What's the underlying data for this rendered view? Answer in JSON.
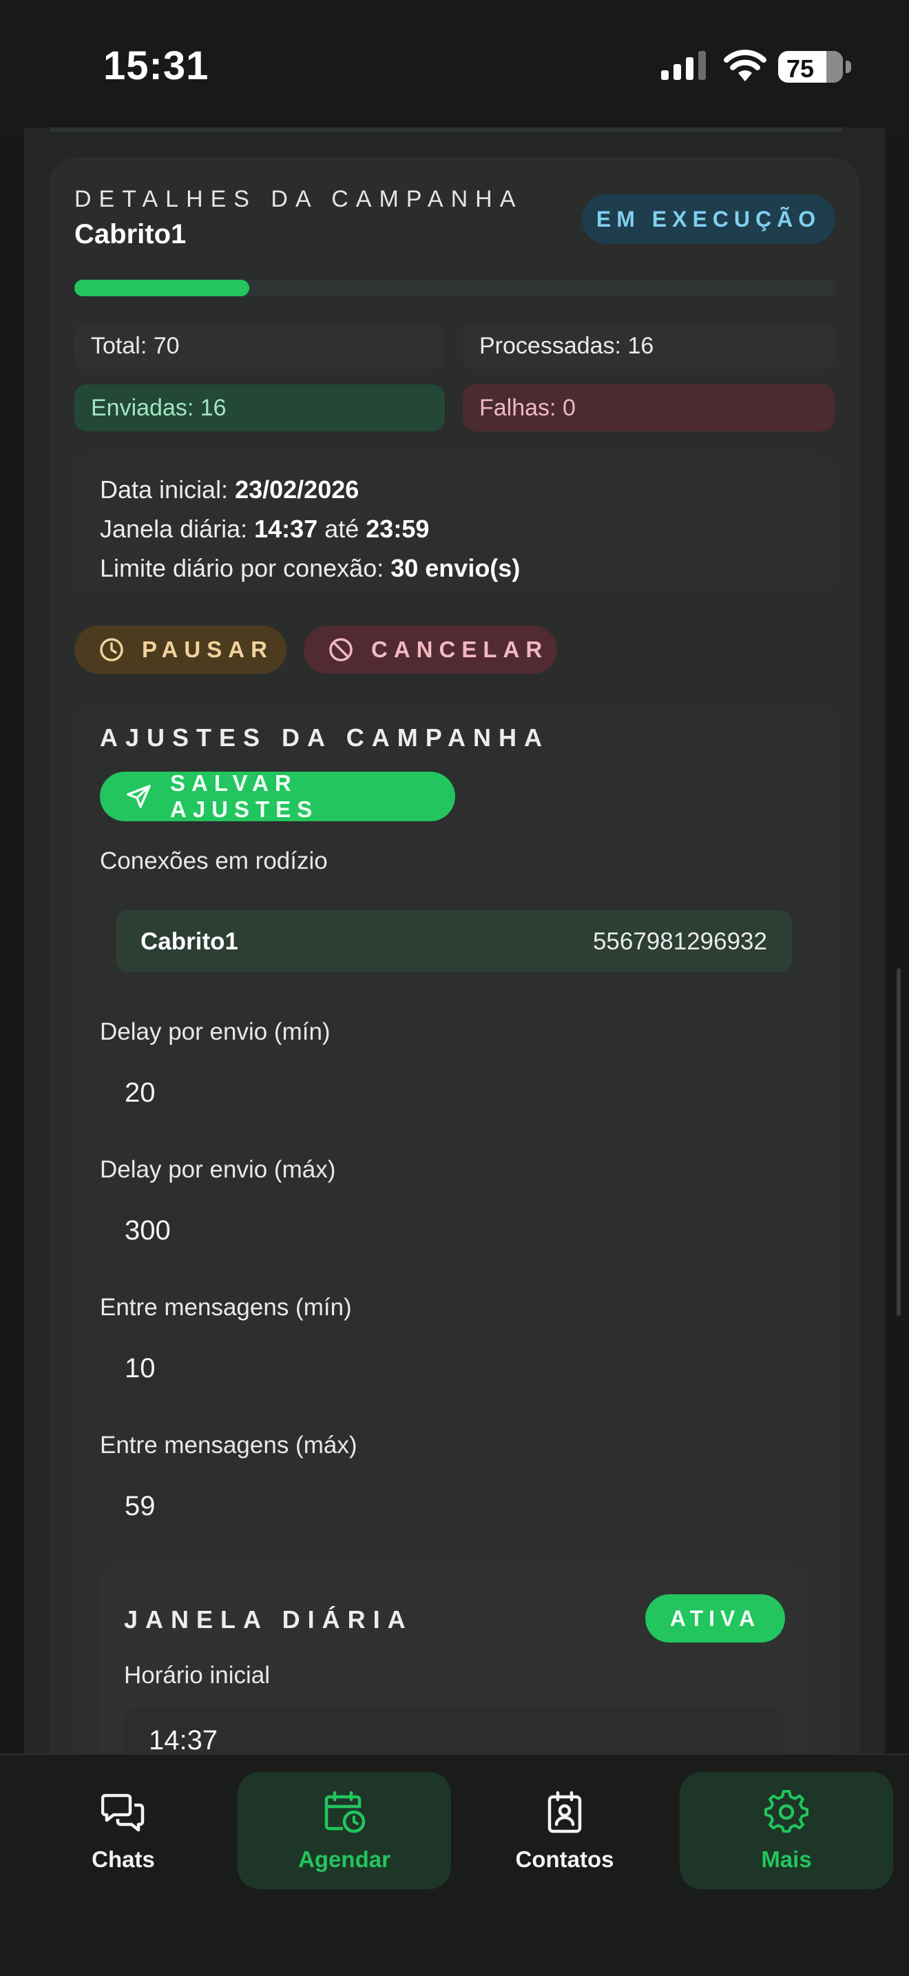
{
  "status_bar": {
    "time": "15:31",
    "battery": "75"
  },
  "campaign": {
    "eyebrow": "DETALHES DA CAMPANHA",
    "name": "Cabrito1",
    "status": "EM EXECUÇÃO",
    "progress": 0.23,
    "stats": {
      "total": "Total: 70",
      "processed": "Processadas: 16",
      "sent": "Enviadas: 16",
      "failed": "Falhas: 0"
    },
    "info": {
      "start_label": "Data inicial: ",
      "start_value": "23/02/2026",
      "window_label": "Janela diária: ",
      "window_start": "14:37",
      "window_sep": " até ",
      "window_end": "23:59",
      "limit_label": "Limite diário por conexão: ",
      "limit_value": "30 envio(s)"
    },
    "actions": {
      "pause": "PAUSAR",
      "cancel": "CANCELAR"
    }
  },
  "adjustments": {
    "title": "AJUSTES DA CAMPANHA",
    "save_label": "SALVAR AJUSTES",
    "connections_label": "Conexões em rodízio",
    "connection": {
      "name": "Cabrito1",
      "phone": "5567981296932"
    },
    "fields": [
      {
        "label": "Delay por envio (mín)",
        "value": "20"
      },
      {
        "label": "Delay por envio (máx)",
        "value": "300"
      },
      {
        "label": "Entre mensagens (mín)",
        "value": "10"
      },
      {
        "label": "Entre mensagens (máx)",
        "value": "59"
      }
    ],
    "daily_window": {
      "title": "JANELA DIÁRIA",
      "status": "ATIVA",
      "start_label": "Horário inicial",
      "start_value": "14:37"
    }
  },
  "tabs": [
    {
      "label": "Chats",
      "icon": "chat-icon",
      "active": false
    },
    {
      "label": "Agendar",
      "icon": "calendar-clock-icon",
      "active": true
    },
    {
      "label": "Contatos",
      "icon": "contact-card-icon",
      "active": false
    },
    {
      "label": "Mais",
      "icon": "gear-icon",
      "active": true
    }
  ],
  "colors": {
    "accent": "#22c55e",
    "running_badge": "#1e3d4d",
    "sent_bg": "#234838",
    "failed_bg": "#4c2a31",
    "pause_bg": "#4c3b1e",
    "cancel_bg": "#512a32"
  }
}
